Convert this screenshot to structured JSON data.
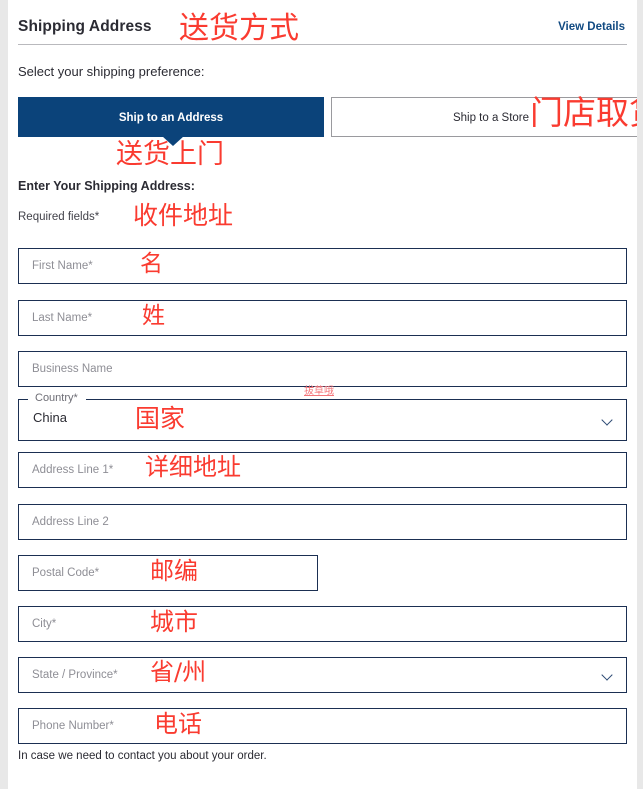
{
  "header": {
    "title": "Shipping Address",
    "title_annotation": "送货方式",
    "view_details": "View Details"
  },
  "preference": {
    "label": "Select your shipping preference:",
    "tabs": [
      {
        "label": "Ship to an Address",
        "annotation": "送货上门",
        "selected": true
      },
      {
        "label": "Ship to a Store",
        "annotation": "门店取货",
        "selected": false
      }
    ]
  },
  "form": {
    "heading": "Enter Your Shipping Address:",
    "required_note": "Required fields*",
    "required_note_annotation": "收件地址",
    "fields": [
      {
        "name": "first-name",
        "placeholder": "First Name*",
        "annotation": "名",
        "width": "wide",
        "type": "text"
      },
      {
        "name": "last-name",
        "placeholder": "Last Name*",
        "annotation": "姓",
        "width": "wide",
        "type": "text"
      },
      {
        "name": "business-name",
        "placeholder": "Business Name",
        "annotation": "",
        "width": "wide",
        "type": "text"
      },
      {
        "name": "country",
        "placeholder": "Country*",
        "annotation": "国家",
        "width": "wide",
        "type": "select",
        "value": "China",
        "note": "拔草哦"
      },
      {
        "name": "address-line-1",
        "placeholder": "Address Line 1*",
        "annotation": "详细地址",
        "width": "wide",
        "type": "text"
      },
      {
        "name": "address-line-2",
        "placeholder": "Address Line 2",
        "annotation": "",
        "width": "wide",
        "type": "text"
      },
      {
        "name": "postal-code",
        "placeholder": "Postal Code*",
        "annotation": "邮编",
        "width": "narrow",
        "type": "text"
      },
      {
        "name": "city",
        "placeholder": "City*",
        "annotation": "城市",
        "width": "wide",
        "type": "text"
      },
      {
        "name": "state-province",
        "placeholder": "State / Province*",
        "annotation": "省/州",
        "width": "wide",
        "type": "text-select"
      },
      {
        "name": "phone-number",
        "placeholder": "Phone Number*",
        "annotation": "电话",
        "width": "wide",
        "type": "text"
      }
    ],
    "helper_text": "In case we need to contact you about your order."
  },
  "colors": {
    "brand_navy": "#0b437a",
    "link_navy": "#114a82",
    "field_border": "#1b2f52",
    "annotation_red": "#fa3b30",
    "page_bg": "#ffffff",
    "outer_bg": "#e8e8e8"
  }
}
